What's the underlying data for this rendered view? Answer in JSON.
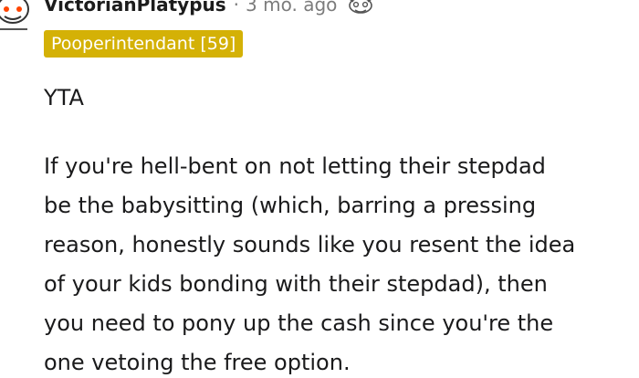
{
  "comment": {
    "username": "VictorianPlatypus",
    "separator": "·",
    "time": "3 mo. ago",
    "flair": "Pooperintendant [59]",
    "verdict": "YTA",
    "body_lines": [
      "If you're hell-bent on not letting their stepdad",
      "be the babysitting (which, barring a pressing",
      "reason, honestly sounds like you resent the idea",
      "of your kids bonding with their stepdad), then",
      "you need to pony up the cash since you're the",
      "one vetoing the free option."
    ],
    "icons": {
      "avatar": "snoo-avatar-icon",
      "award": "award-icon"
    },
    "colors": {
      "flair_background": "#d4b106",
      "flair_text": "#ffffff",
      "meta_text": "#7c7c7c",
      "body_text": "#1a1a1b"
    }
  }
}
